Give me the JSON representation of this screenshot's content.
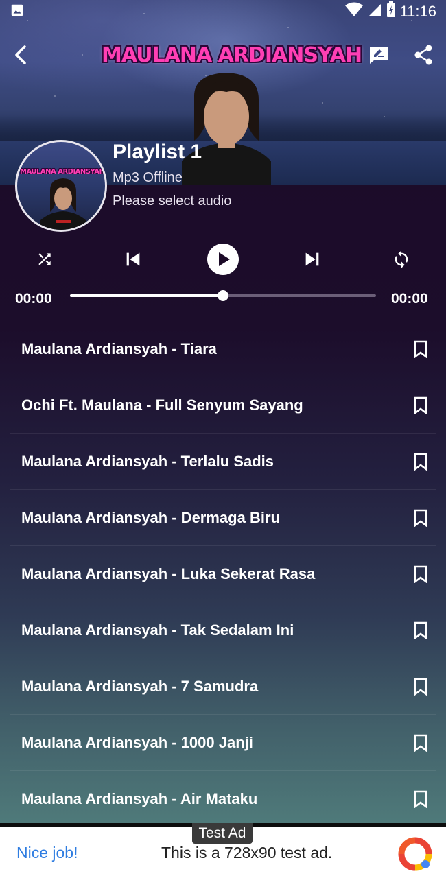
{
  "status_bar": {
    "time": "11:16"
  },
  "header": {
    "banner_title": "MAULANA ARDIANSYAH"
  },
  "playlist": {
    "avatar_title": "MAULANA ARDIANSYAH",
    "title": "Playlist 1",
    "subtitle": "Mp3 Offline",
    "status": "Please select audio"
  },
  "player": {
    "current_time": "00:00",
    "total_time": "00:00",
    "progress_fraction": 0.5
  },
  "tracks": [
    {
      "title": "Maulana Ardiansyah - Tiara"
    },
    {
      "title": "Ochi Ft. Maulana - Full Senyum Sayang"
    },
    {
      "title": "Maulana Ardiansyah - Terlalu Sadis"
    },
    {
      "title": "Maulana Ardiansyah - Dermaga Biru"
    },
    {
      "title": "Maulana Ardiansyah - Luka Sekerat Rasa"
    },
    {
      "title": "Maulana Ardiansyah - Tak Sedalam Ini"
    },
    {
      "title": "Maulana Ardiansyah - 7 Samudra"
    },
    {
      "title": "Maulana Ardiansyah - 1000 Janji"
    },
    {
      "title": "Maulana Ardiansyah - Air Mataku"
    }
  ],
  "ad": {
    "label": "Test Ad",
    "nice": "Nice job!",
    "text": "This is a 728x90 test ad."
  },
  "colors": {
    "background_top": "#1b0a27",
    "background_bottom": "#4f7a7a",
    "banner_title": "#ff3fb4",
    "ad_link": "#2f7de1"
  },
  "icons": {
    "status_left": "image-icon",
    "status_wifi": "wifi-icon",
    "status_signal": "signal-icon",
    "status_battery": "battery-charging-icon",
    "back": "arrow-back-icon",
    "rate": "rate-review-icon",
    "share": "share-icon",
    "shuffle": "shuffle-icon",
    "previous": "skip-previous-icon",
    "play": "play-icon",
    "next": "skip-next-icon",
    "repeat": "repeat-icon",
    "bookmark": "bookmark-outline-icon"
  }
}
